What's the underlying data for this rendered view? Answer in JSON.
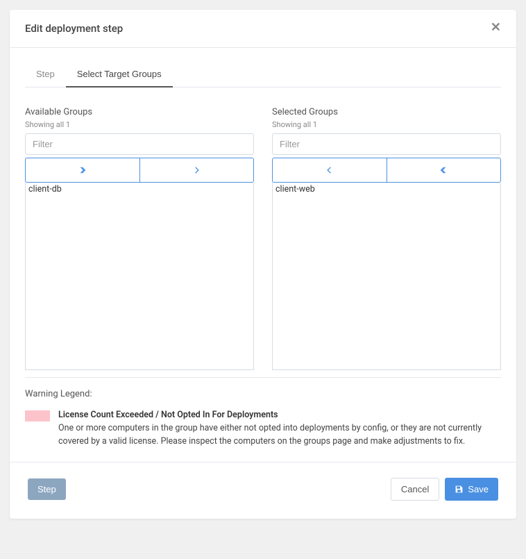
{
  "modal": {
    "title": "Edit deployment step"
  },
  "tabs": {
    "items": [
      {
        "label": "Step"
      },
      {
        "label": "Select Target Groups"
      }
    ]
  },
  "available": {
    "title": "Available Groups",
    "subtitle": "Showing all 1",
    "filterPlaceholder": "Filter",
    "items": [
      {
        "label": "client-db"
      }
    ]
  },
  "selected": {
    "title": "Selected Groups",
    "subtitle": "Showing all 1",
    "filterPlaceholder": "Filter",
    "items": [
      {
        "label": "client-web"
      }
    ]
  },
  "warning": {
    "legendLabel": "Warning Legend:",
    "heading": "License Count Exceeded / Not Opted In For Deployments",
    "body": "One or more computers in the group have either not opted into deployments by config, or they are not currently covered by a valid license. Please inspect the computers on the groups page and make adjustments to fix.",
    "swatchColor": "#fcc3cb"
  },
  "footer": {
    "stepLabel": "Step",
    "cancelLabel": "Cancel",
    "saveLabel": "Save"
  }
}
